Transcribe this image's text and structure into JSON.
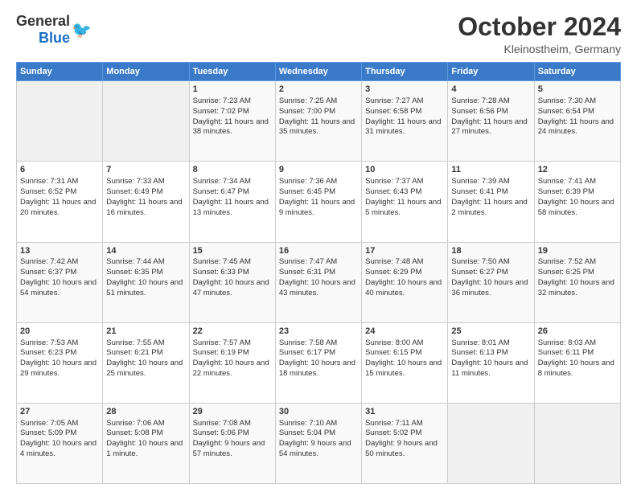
{
  "header": {
    "logo_general": "General",
    "logo_blue": "Blue",
    "month": "October 2024",
    "location": "Kleinostheim, Germany"
  },
  "weekdays": [
    "Sunday",
    "Monday",
    "Tuesday",
    "Wednesday",
    "Thursday",
    "Friday",
    "Saturday"
  ],
  "weeks": [
    [
      {
        "day": "",
        "empty": true
      },
      {
        "day": "",
        "empty": true
      },
      {
        "day": "1",
        "sunrise": "Sunrise: 7:23 AM",
        "sunset": "Sunset: 7:02 PM",
        "daylight": "Daylight: 11 hours and 38 minutes."
      },
      {
        "day": "2",
        "sunrise": "Sunrise: 7:25 AM",
        "sunset": "Sunset: 7:00 PM",
        "daylight": "Daylight: 11 hours and 35 minutes."
      },
      {
        "day": "3",
        "sunrise": "Sunrise: 7:27 AM",
        "sunset": "Sunset: 6:58 PM",
        "daylight": "Daylight: 11 hours and 31 minutes."
      },
      {
        "day": "4",
        "sunrise": "Sunrise: 7:28 AM",
        "sunset": "Sunset: 6:56 PM",
        "daylight": "Daylight: 11 hours and 27 minutes."
      },
      {
        "day": "5",
        "sunrise": "Sunrise: 7:30 AM",
        "sunset": "Sunset: 6:54 PM",
        "daylight": "Daylight: 11 hours and 24 minutes."
      }
    ],
    [
      {
        "day": "6",
        "sunrise": "Sunrise: 7:31 AM",
        "sunset": "Sunset: 6:52 PM",
        "daylight": "Daylight: 11 hours and 20 minutes."
      },
      {
        "day": "7",
        "sunrise": "Sunrise: 7:33 AM",
        "sunset": "Sunset: 6:49 PM",
        "daylight": "Daylight: 11 hours and 16 minutes."
      },
      {
        "day": "8",
        "sunrise": "Sunrise: 7:34 AM",
        "sunset": "Sunset: 6:47 PM",
        "daylight": "Daylight: 11 hours and 13 minutes."
      },
      {
        "day": "9",
        "sunrise": "Sunrise: 7:36 AM",
        "sunset": "Sunset: 6:45 PM",
        "daylight": "Daylight: 11 hours and 9 minutes."
      },
      {
        "day": "10",
        "sunrise": "Sunrise: 7:37 AM",
        "sunset": "Sunset: 6:43 PM",
        "daylight": "Daylight: 11 hours and 5 minutes."
      },
      {
        "day": "11",
        "sunrise": "Sunrise: 7:39 AM",
        "sunset": "Sunset: 6:41 PM",
        "daylight": "Daylight: 11 hours and 2 minutes."
      },
      {
        "day": "12",
        "sunrise": "Sunrise: 7:41 AM",
        "sunset": "Sunset: 6:39 PM",
        "daylight": "Daylight: 10 hours and 58 minutes."
      }
    ],
    [
      {
        "day": "13",
        "sunrise": "Sunrise: 7:42 AM",
        "sunset": "Sunset: 6:37 PM",
        "daylight": "Daylight: 10 hours and 54 minutes."
      },
      {
        "day": "14",
        "sunrise": "Sunrise: 7:44 AM",
        "sunset": "Sunset: 6:35 PM",
        "daylight": "Daylight: 10 hours and 51 minutes."
      },
      {
        "day": "15",
        "sunrise": "Sunrise: 7:45 AM",
        "sunset": "Sunset: 6:33 PM",
        "daylight": "Daylight: 10 hours and 47 minutes."
      },
      {
        "day": "16",
        "sunrise": "Sunrise: 7:47 AM",
        "sunset": "Sunset: 6:31 PM",
        "daylight": "Daylight: 10 hours and 43 minutes."
      },
      {
        "day": "17",
        "sunrise": "Sunrise: 7:48 AM",
        "sunset": "Sunset: 6:29 PM",
        "daylight": "Daylight: 10 hours and 40 minutes."
      },
      {
        "day": "18",
        "sunrise": "Sunrise: 7:50 AM",
        "sunset": "Sunset: 6:27 PM",
        "daylight": "Daylight: 10 hours and 36 minutes."
      },
      {
        "day": "19",
        "sunrise": "Sunrise: 7:52 AM",
        "sunset": "Sunset: 6:25 PM",
        "daylight": "Daylight: 10 hours and 32 minutes."
      }
    ],
    [
      {
        "day": "20",
        "sunrise": "Sunrise: 7:53 AM",
        "sunset": "Sunset: 6:23 PM",
        "daylight": "Daylight: 10 hours and 29 minutes."
      },
      {
        "day": "21",
        "sunrise": "Sunrise: 7:55 AM",
        "sunset": "Sunset: 6:21 PM",
        "daylight": "Daylight: 10 hours and 25 minutes."
      },
      {
        "day": "22",
        "sunrise": "Sunrise: 7:57 AM",
        "sunset": "Sunset: 6:19 PM",
        "daylight": "Daylight: 10 hours and 22 minutes."
      },
      {
        "day": "23",
        "sunrise": "Sunrise: 7:58 AM",
        "sunset": "Sunset: 6:17 PM",
        "daylight": "Daylight: 10 hours and 18 minutes."
      },
      {
        "day": "24",
        "sunrise": "Sunrise: 8:00 AM",
        "sunset": "Sunset: 6:15 PM",
        "daylight": "Daylight: 10 hours and 15 minutes."
      },
      {
        "day": "25",
        "sunrise": "Sunrise: 8:01 AM",
        "sunset": "Sunset: 6:13 PM",
        "daylight": "Daylight: 10 hours and 11 minutes."
      },
      {
        "day": "26",
        "sunrise": "Sunrise: 8:03 AM",
        "sunset": "Sunset: 6:11 PM",
        "daylight": "Daylight: 10 hours and 8 minutes."
      }
    ],
    [
      {
        "day": "27",
        "sunrise": "Sunrise: 7:05 AM",
        "sunset": "Sunset: 5:09 PM",
        "daylight": "Daylight: 10 hours and 4 minutes."
      },
      {
        "day": "28",
        "sunrise": "Sunrise: 7:06 AM",
        "sunset": "Sunset: 5:08 PM",
        "daylight": "Daylight: 10 hours and 1 minute."
      },
      {
        "day": "29",
        "sunrise": "Sunrise: 7:08 AM",
        "sunset": "Sunset: 5:06 PM",
        "daylight": "Daylight: 9 hours and 57 minutes."
      },
      {
        "day": "30",
        "sunrise": "Sunrise: 7:10 AM",
        "sunset": "Sunset: 5:04 PM",
        "daylight": "Daylight: 9 hours and 54 minutes."
      },
      {
        "day": "31",
        "sunrise": "Sunrise: 7:11 AM",
        "sunset": "Sunset: 5:02 PM",
        "daylight": "Daylight: 9 hours and 50 minutes."
      },
      {
        "day": "",
        "empty": true
      },
      {
        "day": "",
        "empty": true
      }
    ]
  ]
}
